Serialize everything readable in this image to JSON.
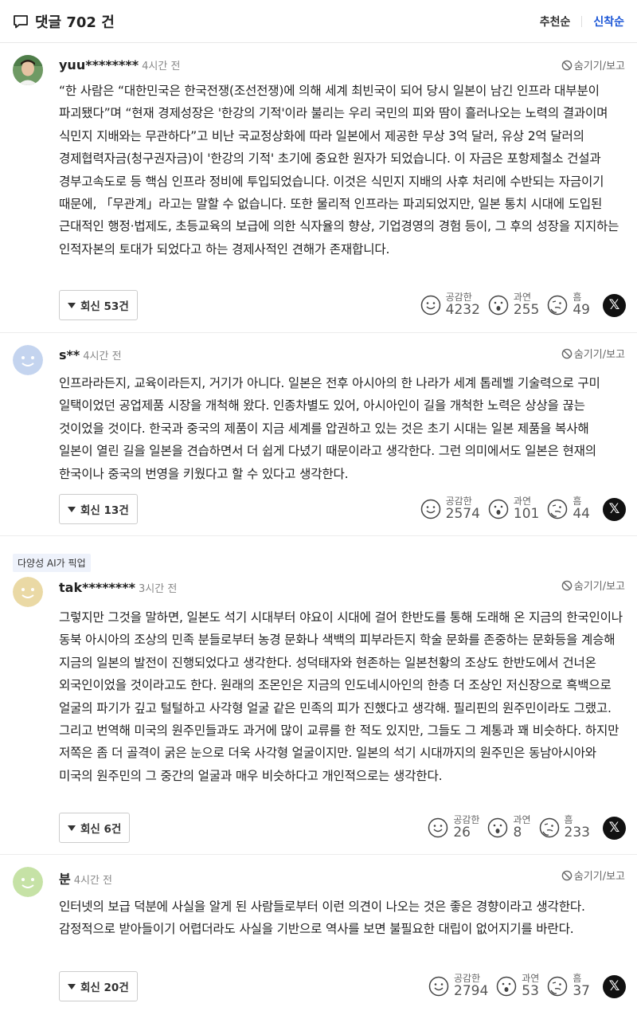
{
  "header": {
    "title": "댓글 702 건",
    "sort_recommend": "추천순",
    "sort_newest": "신착순"
  },
  "hide_label": "숨기기/보고",
  "reaction_names": {
    "like": "공감한",
    "wow": "과연",
    "hmm": "흠"
  },
  "x_label": "𝕏",
  "comments": [
    {
      "user": "yuu********",
      "time": "4시간 전",
      "text": "“한 사람은 “대한민국은 한국전쟁(조선전쟁)에 의해 세계 최빈국이 되어 당시 일본이 남긴 인프라 대부분이 파괴됐다”며 “현재 경제성장은 '한강의 기적'이라 불리는 우리 국민의 피와 땀이 흘러나오는 노력의 결과이며 식민지 지배와는 무관하다”고 비난 국교정상화에 따라 일본에서 제공한 무상 3억 달러, 유상 2억 달러의 경제협력자금(청구권자금)이 '한강의 기적' 초기에 중요한 원자가 되었습니다. 이 자금은 포항제철소 건설과 경부고속도로 등 핵심 인프라 정비에 투입되었습니다. 이것은 식민지 지배의 사후 처리에 수반되는 자금이기 때문에, 「무관계」라고는 말할 수 없습니다. 또한 물리적 인프라는 파괴되었지만, 일본 통치 시대에 도입된 근대적인 행정·법제도, 초등교육의 보급에 의한 식자율의 향상, 기업경영의 경험 등이, 그 후의 성장을 지지하는 인적자본의 토대가 되었다고 하는 경제사적인 견해가 존재합니다.",
      "replies": "회신 53건",
      "like": "4232",
      "wow": "255",
      "hmm": "49"
    },
    {
      "user": "s**",
      "time": "4시간 전",
      "text": "인프라라든지, 교육이라든지, 거기가 아니다. 일본은 전후 아시아의 한 나라가 세계 톱레벨 기술력으로 구미 일택이었던 공업제품 시장을 개척해 왔다. 인종차별도 있어, 아시아인이 길을 개척한 노력은 상상을 끊는 것이었을 것이다. 한국과 중국의 제품이 지금 세계를 압권하고 있는 것은 초기 시대는 일본 제품을 복사해 일본이 열린 길을 일본을 견습하면서 더 쉽게 다녔기 때문이라고 생각한다. 그런 의미에서도 일본은 현재의 한국이나 중국의 번영을 키웠다고 할 수 있다고 생각한다.",
      "replies": "회신 13건",
      "like": "2574",
      "wow": "101",
      "hmm": "44"
    },
    {
      "badge": "다양성 AI가 픽업",
      "user": "tak********",
      "time": "3시간 전",
      "text": "그렇지만 그것을 말하면, 일본도 석기 시대부터 야요이 시대에 걸어 한반도를 통해 도래해 온 지금의 한국인이나 동북 아시아의 조상의 민족 분들로부터 농경 문화나 색백의 피부라든지 학술 문화를 존중하는 문화등을 계승해 지금의 일본의 발전이 진행되었다고 생각한다. 성덕태자와 현존하는 일본천황의 조상도 한반도에서 건너온 외국인이었을 것이라고도 한다. 원래의 조몬인은 지금의 인도네시아인의 한층 더 조상인 저신장으로 흑백으로 얼굴의 파기가 깊고 털털하고 사각형 얼굴 같은 민족의 피가 진했다고 생각해. 필리핀의 원주민이라도 그랬고. 그리고 번역해 미국의 원주민들과도 과거에 많이 교류를 한 적도 있지만, 그들도 그 계통과 꽤 비슷하다. 하지만 저쪽은 좀 더 골격이 굵은 눈으로 더욱 사각형 얼굴이지만. 일본의 석기 시대까지의 원주민은 동남아시아와 미국의 원주민의 그 중간의 얼굴과 매우 비슷하다고 개인적으로는 생각한다.",
      "replies": "회신 6건",
      "like": "26",
      "wow": "8",
      "hmm": "233"
    },
    {
      "user": "분",
      "time": "4시간 전",
      "text": "인터넷의 보급 덕분에 사실을 알게 된 사람들로부터 이런 의견이 나오는 것은 좋은 경향이라고 생각한다. 감정적으로 받아들이기 어렵더라도 사실을 기반으로 역사를 보면 불필요한 대립이 없어지기를 바란다.",
      "replies": "회신 20건",
      "like": "2794",
      "wow": "53",
      "hmm": "37"
    }
  ]
}
